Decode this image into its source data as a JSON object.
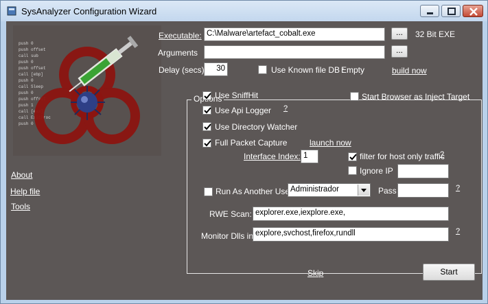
{
  "window": {
    "title": "SysAnalyzer Configuration Wizard"
  },
  "left": {
    "art_code_lines": [
      "push    0",
      "push    offset",
      "call    sub",
      "push    0",
      "push    offset",
      "call    [ebp]",
      "push    0",
      "call    Sleep",
      "push    0",
      "push    offset",
      "push    1",
      "call    [eax]",
      "call    ExitProc",
      "push    0"
    ],
    "links": {
      "about": "About",
      "help": "Help file",
      "tools": "Tools"
    }
  },
  "top": {
    "executable_label": "Executable:",
    "executable_value": "C:\\Malware\\artefact_cobalt.exe",
    "browse_label": "...",
    "exe_type": "32 Bit EXE",
    "arguments_label": "Arguments",
    "arguments_value": "",
    "delay_label": "Delay (secs)",
    "delay_value": "30",
    "known_db_label": "Use Known file DB :",
    "known_db_status": "Empty",
    "build_now": "build now"
  },
  "options": {
    "legend": "Options",
    "sniffhit": "Use SniffHit",
    "api_logger": "Use Api Logger",
    "help_mark": "?",
    "dir_watcher": "Use Directory Watcher",
    "packet_capture": "Full Packet Capture",
    "launch_now": "launch now",
    "inject_target": "Start Browser as Inject Target",
    "interface_label": "Interface Index:",
    "interface_value": "1",
    "filter_host": "filter for host only traffic",
    "ignore_ip": "Ignore IP",
    "run_as_label": "Run As Another User",
    "run_as_user": "Administrador",
    "pass_label": "Pass",
    "rwe_label": "RWE Scan:",
    "rwe_value": "explorer.exe,iexplore.exe,",
    "monitor_label": "Monitor Dlls in:",
    "monitor_value": "explore,svchost,firefox,rundll"
  },
  "bottom": {
    "skip": "Skip",
    "start": "Start"
  }
}
